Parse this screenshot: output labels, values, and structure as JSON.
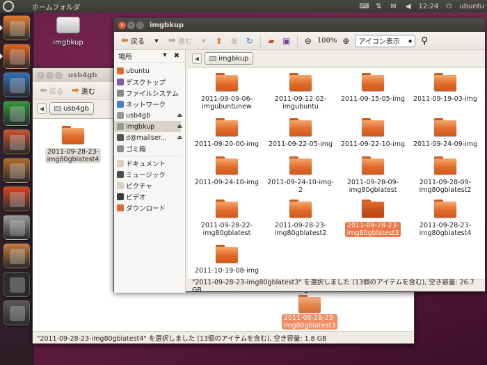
{
  "top_panel": {
    "app_title": "ホームフォルダ",
    "clock": "12:24",
    "user": "ubuntu"
  },
  "desktop": {
    "drive_label": "imgbkup"
  },
  "back_window": {
    "title": "usb4gb",
    "toolbar": {
      "back": "戻る",
      "forward": "進む"
    },
    "crumb": "usb4gb",
    "item": "2011-09-28-23-img80gblatest4",
    "status": "\"2011-09-28-23-img80gblatest4\" を選択しました (13個のアイテムを含む), 空き容量: 1.8 GB"
  },
  "front_window": {
    "title": "imgbkup",
    "toolbar": {
      "back": "戻る",
      "forward": "進む",
      "zoom": "100%",
      "view_mode": "アイコン表示"
    },
    "crumb": "imgbkup",
    "sidebar_title": "場所",
    "places": [
      {
        "label": "ubuntu",
        "color": "#d96d32"
      },
      {
        "label": "デスクトップ",
        "color": "#7d5fa8"
      },
      {
        "label": "ファイルシステム",
        "color": "#888888"
      },
      {
        "label": "ネットワーク",
        "color": "#4a7fc0"
      },
      {
        "label": "usb4gb",
        "color": "#999999"
      },
      {
        "label": "imgbkup",
        "color": "#999999"
      },
      {
        "label": "d@mailser...",
        "color": "#555555"
      },
      {
        "label": "ゴミ箱",
        "color": "#8a8a8a"
      },
      {
        "label": "ドキュメント",
        "color": "#d9d0c0"
      },
      {
        "label": "ミュージック",
        "color": "#4d4d4d"
      },
      {
        "label": "ピクチャ",
        "color": "#d9d0c0"
      },
      {
        "label": "ビデオ",
        "color": "#3c3c3c"
      },
      {
        "label": "ダウンロード",
        "color": "#d96d32"
      }
    ],
    "files": [
      {
        "name": "2011-09-09-06-imgubuntunew",
        "line1": "2011-09-09-06-",
        "line2": "imgubuntunew"
      },
      {
        "name": "2011-09-12-02-imgubuntu",
        "line1": "2011-09-12-02-",
        "line2": "imgubuntu"
      },
      {
        "name": "2011-09-15-05-img",
        "line1": "2011-09-15-05-img",
        "line2": ""
      },
      {
        "name": "2011-09-19-03-img",
        "line1": "2011-09-19-03-img",
        "line2": ""
      },
      {
        "name": "2011-09-20-00-img",
        "line1": "2011-09-20-00-img",
        "line2": ""
      },
      {
        "name": "2011-09-22-05-img",
        "line1": "2011-09-22-05-img",
        "line2": ""
      },
      {
        "name": "2011-09-22-10-img",
        "line1": "2011-09-22-10-img",
        "line2": ""
      },
      {
        "name": "2011-09-24-09-img",
        "line1": "2011-09-24-09-img",
        "line2": ""
      },
      {
        "name": "2011-09-24-10-img",
        "line1": "2011-09-24-10-img",
        "line2": ""
      },
      {
        "name": "2011-09-24-10-img-2",
        "line1": "2011-09-24-10-img-2",
        "line2": ""
      },
      {
        "name": "2011-09-28-09-img80gblatest",
        "line1": "2011-09-28-09-",
        "line2": "img80gblatest"
      },
      {
        "name": "2011-09-28-09-img80gblatest2",
        "line1": "2011-09-28-09-",
        "line2": "img80gblatest2"
      },
      {
        "name": "2011-09-28-22-img80gblatest",
        "line1": "2011-09-28-22-",
        "line2": "img80gblatest"
      },
      {
        "name": "2011-09-28-23-img80gblatest2",
        "line1": "2011-09-28-23-",
        "line2": "img80gblatest2"
      },
      {
        "name": "2011-09-28-23-img80gblatest3",
        "line1": "2011-09-28-23-",
        "line2": "img80gblatest3",
        "selected": true
      },
      {
        "name": "2011-09-28-23-img80gblatest4",
        "line1": "2011-09-28-23-",
        "line2": "img80gblatest4"
      },
      {
        "name": "2011-10-19-08-img",
        "line1": "2011-10-19-08-img",
        "line2": ""
      }
    ],
    "status": "\"2011-09-28-23-img80gblatest3\" を選択しました (13個のアイテムを含む), 空き容量: 26.7 GB"
  },
  "drag_item": {
    "line1": "2011-09-28-23-",
    "line2": "img80gblatest3"
  },
  "launcher_items": [
    {
      "icon": "home-folder-icon",
      "color": "#e07b2c"
    },
    {
      "icon": "firefox-icon",
      "color": "#e2621b"
    },
    {
      "icon": "writer-icon",
      "color": "#2f6fb5"
    },
    {
      "icon": "calc-icon",
      "color": "#2f9a3a"
    },
    {
      "icon": "impress-icon",
      "color": "#c8542a"
    },
    {
      "icon": "software-center-icon",
      "color": "#b06a2a"
    },
    {
      "icon": "ubuntu-one-icon",
      "color": "#d9451f"
    },
    {
      "icon": "screenshot-icon",
      "color": "#9a9a9a"
    },
    {
      "icon": "update-manager-icon",
      "color": "#c97a3a"
    },
    {
      "icon": "terminal-icon",
      "color": "#2e2e2e"
    },
    {
      "icon": "workspace-switcher-icon",
      "color": "#5a5a5a"
    }
  ]
}
